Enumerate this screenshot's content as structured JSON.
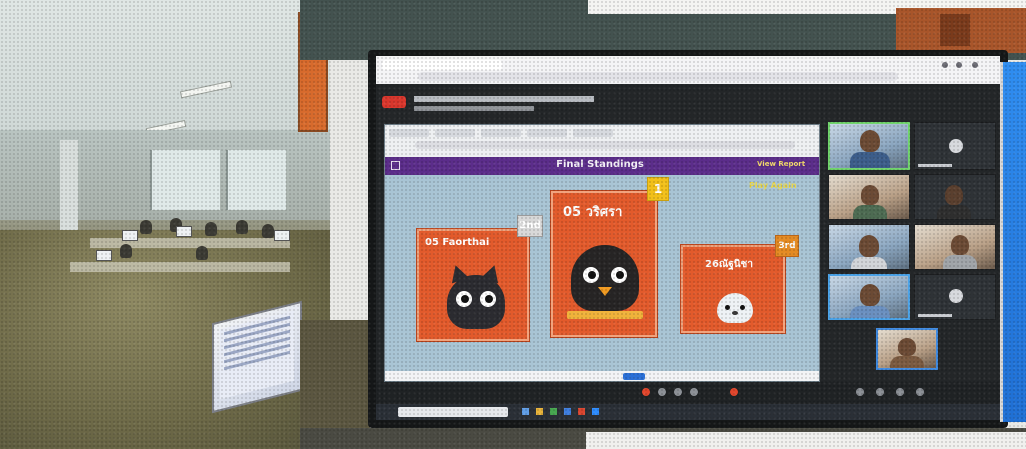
{
  "shared_screen": {
    "banner_title": "Final Standings",
    "banner_right": "View Report",
    "play_again": "Play Again"
  },
  "podium": {
    "second": {
      "name": "05 Faorthai",
      "rank": "2nd"
    },
    "first": {
      "name": "05 วริศรา",
      "rank": "1"
    },
    "third": {
      "name": "26ณัฐนิชา",
      "rank": "3rd"
    }
  },
  "colors": {
    "banner_purple": "#5b2d8a",
    "podium_orange": "#e25a2b",
    "gold": "#f2c019",
    "screen_blue": "#a8c4d4"
  }
}
